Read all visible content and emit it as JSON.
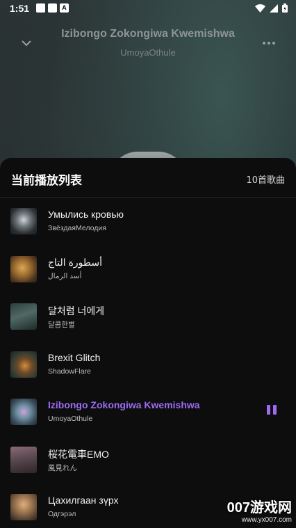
{
  "status_bar": {
    "time": "1:51"
  },
  "now_playing": {
    "title": "Izibongo Zokongiwa Kwemishwa",
    "artist": "UmoyaOthule"
  },
  "playlist": {
    "title": "当前播放列表",
    "count": "10首歌曲",
    "accent_color": "#9b6cf0",
    "items": [
      {
        "title": "Умылись кровью",
        "artist": "ЗвёздаяМелодия",
        "active": false
      },
      {
        "title": "أسطورة التاج",
        "artist": "أسد الرمال",
        "active": false
      },
      {
        "title": "달처럼 너에게",
        "artist": "달콤한별",
        "active": false
      },
      {
        "title": "Brexit Glitch",
        "artist": "ShadowFlare",
        "active": false
      },
      {
        "title": "Izibongo Zokongiwa Kwemishwa",
        "artist": "UmoyaOthule",
        "active": true
      },
      {
        "title": "桜花電車EMO",
        "artist": "風見れん",
        "active": false
      },
      {
        "title": "Цахилгаан зүрх",
        "artist": "Одгэрэл",
        "active": false
      }
    ]
  },
  "watermark": {
    "main": "007游戏网",
    "url": "www.yx007.com"
  }
}
